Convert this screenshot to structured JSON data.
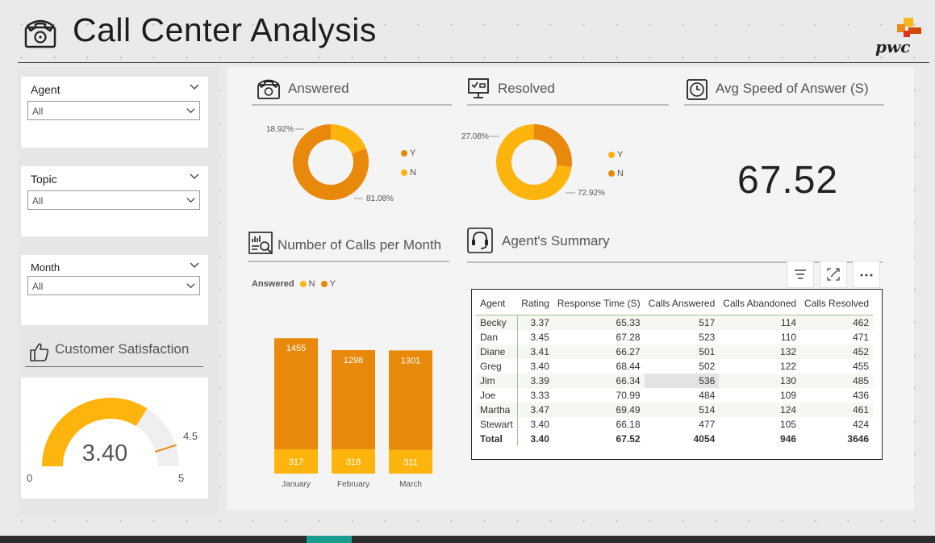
{
  "header": {
    "title": "Call Center Analysis",
    "logo_text": "pwc"
  },
  "filters": [
    {
      "label": "Agent",
      "value": "All"
    },
    {
      "label": "Topic",
      "value": "All"
    },
    {
      "label": "Month",
      "value": "All"
    }
  ],
  "customer_satisfaction": {
    "title": "Customer Satisfaction",
    "value": "3.40",
    "min": "0",
    "max": "5",
    "target": "4.5"
  },
  "answered": {
    "title": "Answered",
    "legend": [
      "Y",
      "N"
    ],
    "labels": [
      "18.92%",
      "81.08%"
    ],
    "colors": {
      "Y": "#e8890c",
      "N": "#fdb50e"
    }
  },
  "resolved": {
    "title": "Resolved",
    "legend": [
      "Y",
      "N"
    ],
    "labels": [
      "27.08%",
      "72.92%"
    ]
  },
  "avg_speed": {
    "title": "Avg Speed of Answer (S)",
    "value": "67.52"
  },
  "calls_per_month": {
    "title": "Number of Calls per Month",
    "legend_title": "Answered",
    "legend": [
      "N",
      "Y"
    ]
  },
  "chart_data": {
    "type": "bar",
    "categories": [
      "January",
      "February",
      "March"
    ],
    "series": [
      {
        "name": "N",
        "values": [
          317,
          318,
          311
        ]
      },
      {
        "name": "Y",
        "values": [
          1455,
          1298,
          1301
        ]
      }
    ]
  },
  "agents_summary": {
    "title": "Agent's Summary",
    "columns": [
      "Agent",
      "Rating",
      "Response Time (S)",
      "Calls Answered",
      "Calls Abandoned",
      "Calls Resolved"
    ],
    "rows": [
      [
        "Becky",
        "3.37",
        "65.33",
        "517",
        "114",
        "462"
      ],
      [
        "Dan",
        "3.45",
        "67.28",
        "523",
        "110",
        "471"
      ],
      [
        "Diane",
        "3.41",
        "66.27",
        "501",
        "132",
        "452"
      ],
      [
        "Greg",
        "3.40",
        "68.44",
        "502",
        "122",
        "455"
      ],
      [
        "Jim",
        "3.39",
        "66.34",
        "536",
        "130",
        "485"
      ],
      [
        "Joe",
        "3.33",
        "70.99",
        "484",
        "109",
        "436"
      ],
      [
        "Martha",
        "3.47",
        "69.49",
        "514",
        "124",
        "461"
      ],
      [
        "Stewart",
        "3.40",
        "66.18",
        "477",
        "105",
        "424"
      ]
    ],
    "total": [
      "Total",
      "3.40",
      "67.52",
      "4054",
      "946",
      "3646"
    ]
  }
}
